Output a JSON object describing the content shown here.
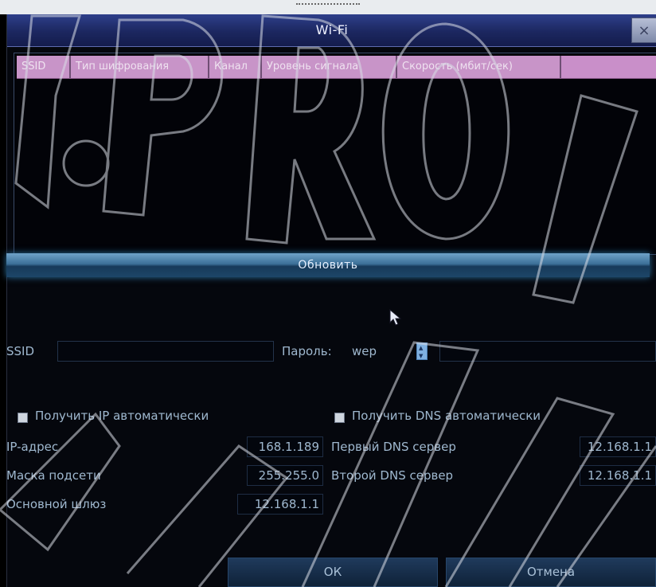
{
  "window": {
    "title": "Wi-Fi",
    "close_glyph": "×"
  },
  "list": {
    "columns": [
      "SSID",
      "Тип шифрования",
      "Канал",
      "Уровень сигнала",
      "Скорость (мбит/сек)"
    ]
  },
  "refresh_label": "Обновить",
  "ssid": {
    "label": "SSID",
    "value": ""
  },
  "password": {
    "label": "Пароль:",
    "encryption": "wep",
    "value": ""
  },
  "ip_section": {
    "auto_ip_label": "Получить IP автоматически",
    "auto_dns_label": "Получить DNS автоматически",
    "ip_label": "IP-адрес",
    "ip_value": "168.1.189",
    "mask_label": "Маска подсети",
    "mask_value": "255.255.0",
    "gateway_label": "Основной шлюз",
    "gateway_value": "12.168.1.1",
    "dns1_label": "Первый DNS сервер",
    "dns1_value": "12.168.1.1",
    "dns2_label": "Второй DNS сервер",
    "dns2_value": "12.168.1.1"
  },
  "buttons": {
    "ok": "ОК",
    "cancel": "Отмена"
  },
  "watermark": "J.PROF.ЛАЙН",
  "colors": {
    "title_bar": "#1c2760",
    "list_header": "#c98fc9",
    "refresh": "#3b6f97",
    "text": "#9fb8cf"
  }
}
